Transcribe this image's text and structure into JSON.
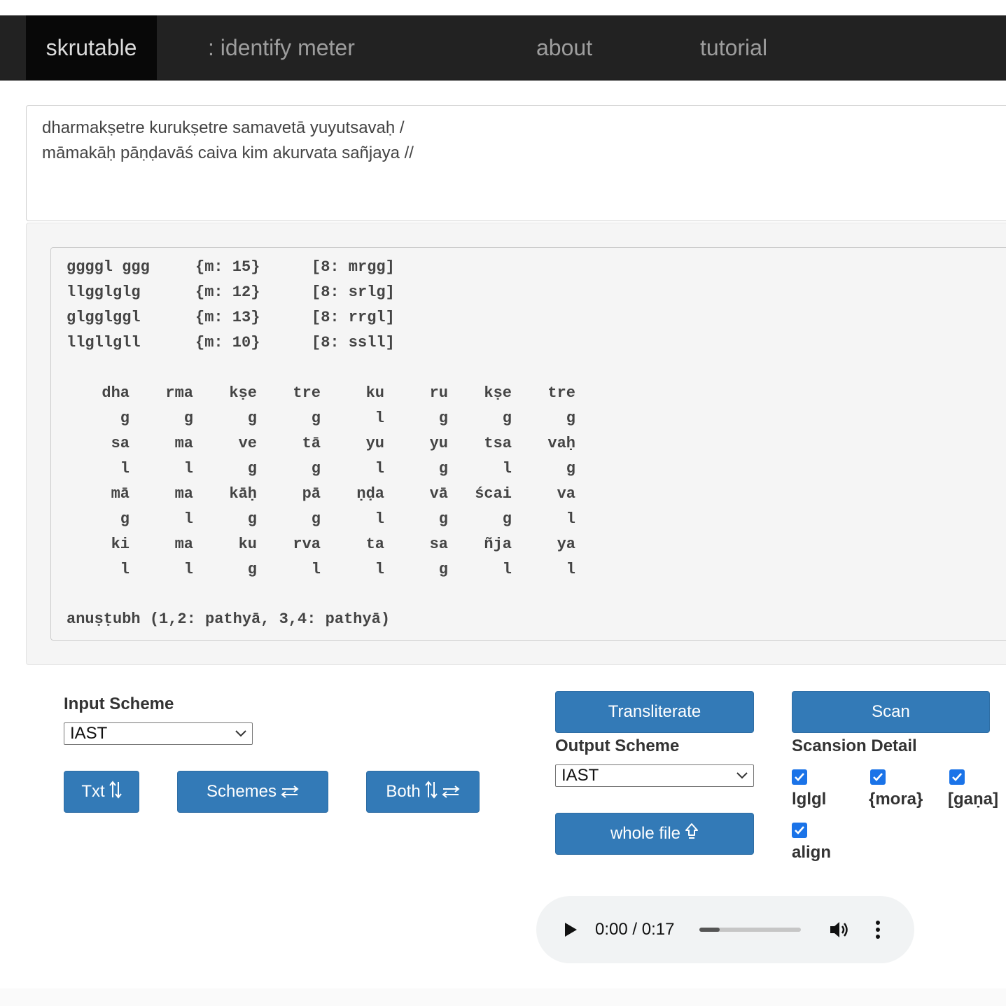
{
  "nav": {
    "brand": "skrutable",
    "page": ": identify meter",
    "about": "about",
    "tutorial": "tutorial"
  },
  "input_text": {
    "line1": "dharmakṣetre kurukṣetre samavetā yuyutsavaḥ /",
    "line2": "māmakāḥ pāṇḍavāś caiva kim akurvata sañjaya //"
  },
  "result": {
    "weights": [
      {
        "pattern": "ggggl ggg",
        "mora": "{m: 15}",
        "gana": "[8: mrgg]"
      },
      {
        "pattern": "llgglglg",
        "mora": "{m: 12}",
        "gana": "[8: srlg]"
      },
      {
        "pattern": "glgglggl",
        "mora": "{m: 13}",
        "gana": "[8: rrgl]"
      },
      {
        "pattern": "llgllgll",
        "mora": "{m: 10}",
        "gana": "[8: ssll]"
      }
    ],
    "aligned": [
      [
        "dha",
        "rma",
        "kṣe",
        "tre",
        "ku",
        "ru",
        "kṣe",
        "tre"
      ],
      [
        "g",
        "g",
        "g",
        "g",
        "l",
        "g",
        "g",
        "g"
      ],
      [
        "sa",
        "ma",
        "ve",
        "tā",
        "yu",
        "yu",
        "tsa",
        "vaḥ"
      ],
      [
        "l",
        "l",
        "g",
        "g",
        "l",
        "g",
        "l",
        "g"
      ],
      [
        "mā",
        "ma",
        "kāḥ",
        "pā",
        "ṇḍa",
        "vā",
        "ścai",
        "va"
      ],
      [
        "g",
        "l",
        "g",
        "g",
        "l",
        "g",
        "g",
        "l"
      ],
      [
        "ki",
        "ma",
        "ku",
        "rva",
        "ta",
        "sa",
        "ñja",
        "ya"
      ],
      [
        "l",
        "l",
        "g",
        "l",
        "l",
        "g",
        "l",
        "l"
      ]
    ],
    "meter": "anuṣṭubh (1,2: pathyā, 3,4: pathyā)"
  },
  "controls": {
    "input_scheme_label": "Input Scheme",
    "input_scheme_value": "IAST",
    "txt_button": "Txt",
    "schemes_button": "Schemes",
    "both_button": "Both",
    "transliterate_button": "Transliterate",
    "output_scheme_label": "Output Scheme",
    "output_scheme_value": "IAST",
    "whole_file_button": "whole file",
    "scan_button": "Scan",
    "scansion_detail_label": "Scansion Detail",
    "checkboxes": [
      {
        "label": "lglgl",
        "checked": true
      },
      {
        "label": "{mora}",
        "checked": true
      },
      {
        "label": "[gaṇa]",
        "checked": true
      },
      {
        "label": "align",
        "checked": true
      }
    ]
  },
  "audio": {
    "time": "0:00 / 0:17",
    "progress": 0.2
  },
  "colors": {
    "navbar": "#222222",
    "brand_bg": "#080808",
    "button": "#337ab7",
    "checkbox": "#1a73e8"
  }
}
